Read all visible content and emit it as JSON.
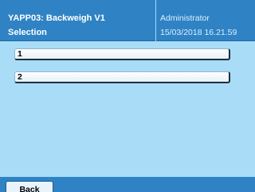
{
  "header": {
    "title_line1": "YAPP03: Backweigh V1",
    "title_line2": "Selection",
    "user": "Administrator",
    "datetime": "15/03/2018 16.21.59"
  },
  "list": {
    "items": [
      {
        "label": "1"
      },
      {
        "label": "2"
      }
    ]
  },
  "footer": {
    "back_label": "Back"
  },
  "colors": {
    "header_bg": "#2f83c4",
    "content_bg": "#a9dcf7",
    "button_bg": "#ffffff"
  }
}
